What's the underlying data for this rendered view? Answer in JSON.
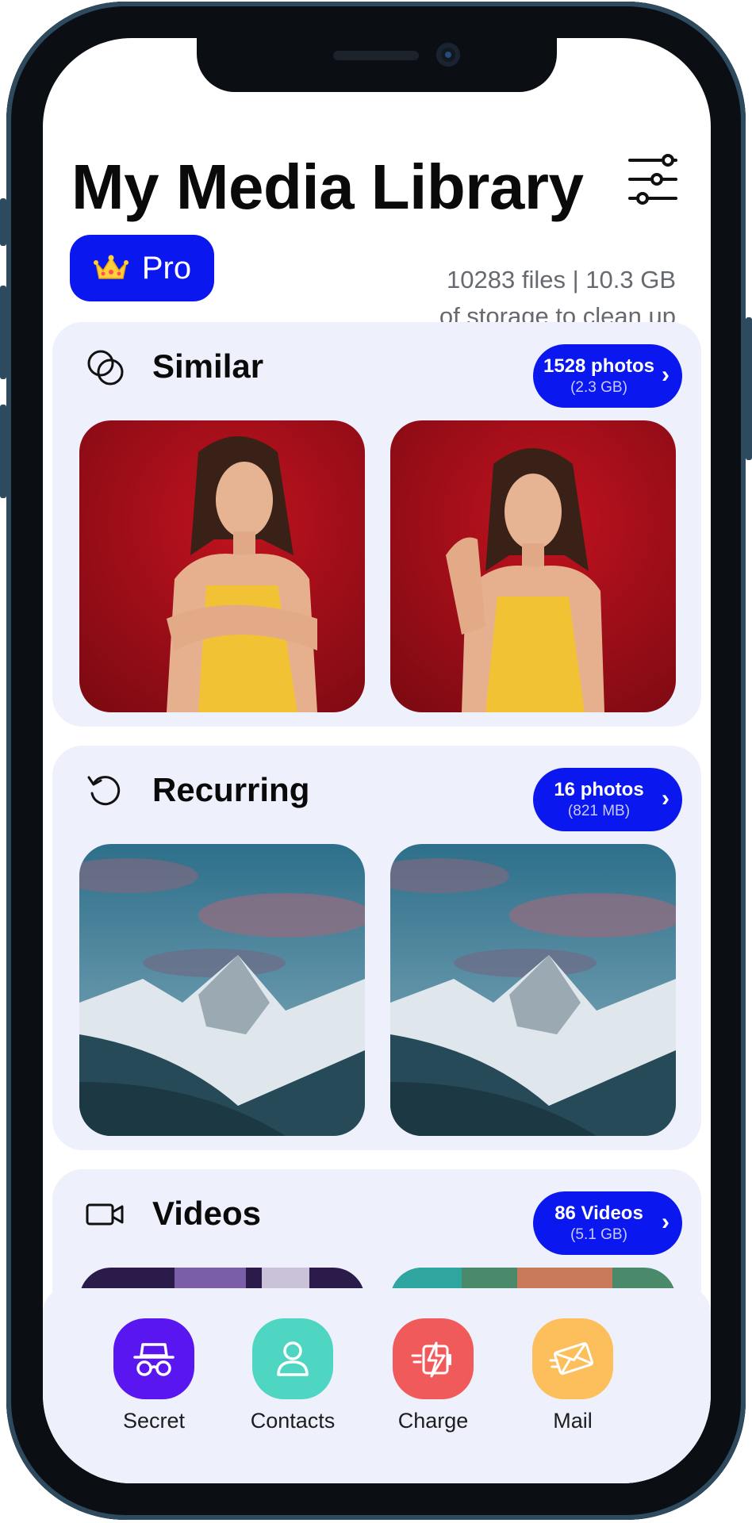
{
  "header": {
    "title": "My Media Library",
    "pro_label": "Pro",
    "storage_line1": "10283 files | 10.3 GB",
    "storage_line2": "of storage to clean up"
  },
  "sections": [
    {
      "title": "Similar",
      "count": "1528 photos",
      "size": "(2.3 GB)",
      "icon": "similar-circles-icon"
    },
    {
      "title": "Recurring",
      "count": "16 photos",
      "size": "(821 MB)",
      "icon": "refresh-icon"
    },
    {
      "title": "Videos",
      "count": "86 Videos",
      "size": "(5.1 GB)",
      "icon": "video-camera-icon"
    }
  ],
  "dock": [
    {
      "label": "Secret",
      "icon": "incognito-icon",
      "color": "#5a16f0"
    },
    {
      "label": "Contacts",
      "icon": "contact-person-icon",
      "color": "#4fd6c2"
    },
    {
      "label": "Charge",
      "icon": "charge-icon",
      "color": "#f05a5a"
    },
    {
      "label": "Mail",
      "icon": "mail-icon",
      "color": "#fcbf5c"
    }
  ],
  "colors": {
    "accent": "#0a17ee",
    "card_bg": "#eef1fc"
  }
}
